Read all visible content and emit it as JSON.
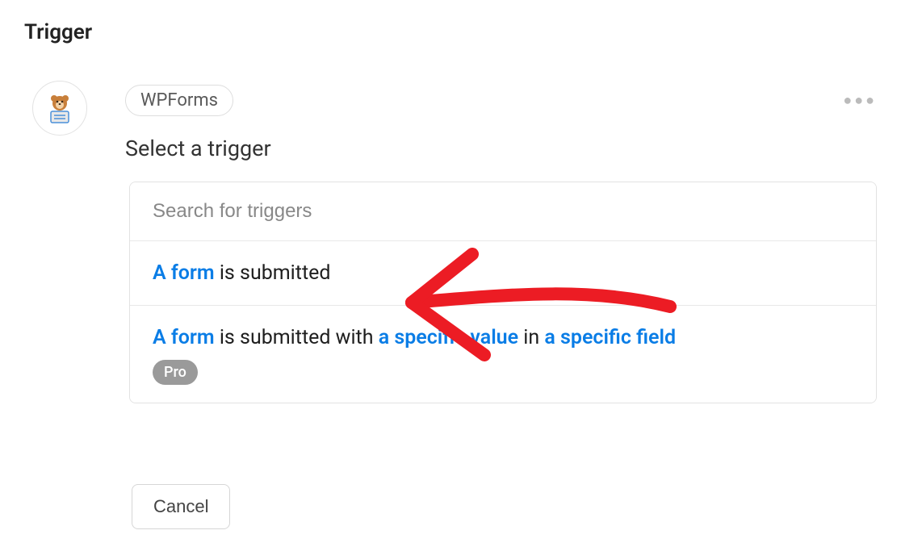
{
  "page": {
    "title": "Trigger",
    "subtitle": "Select a trigger"
  },
  "app": {
    "name": "WPForms"
  },
  "search": {
    "placeholder": "Search for triggers"
  },
  "triggers": [
    {
      "hl1": "A form",
      "text1": " is submitted"
    },
    {
      "hl1": "A form",
      "text1": " is submitted with ",
      "hl2": "a specific value",
      "text2": " in ",
      "hl3": "a specific field",
      "pro_label": "Pro"
    }
  ],
  "buttons": {
    "cancel": "Cancel"
  }
}
